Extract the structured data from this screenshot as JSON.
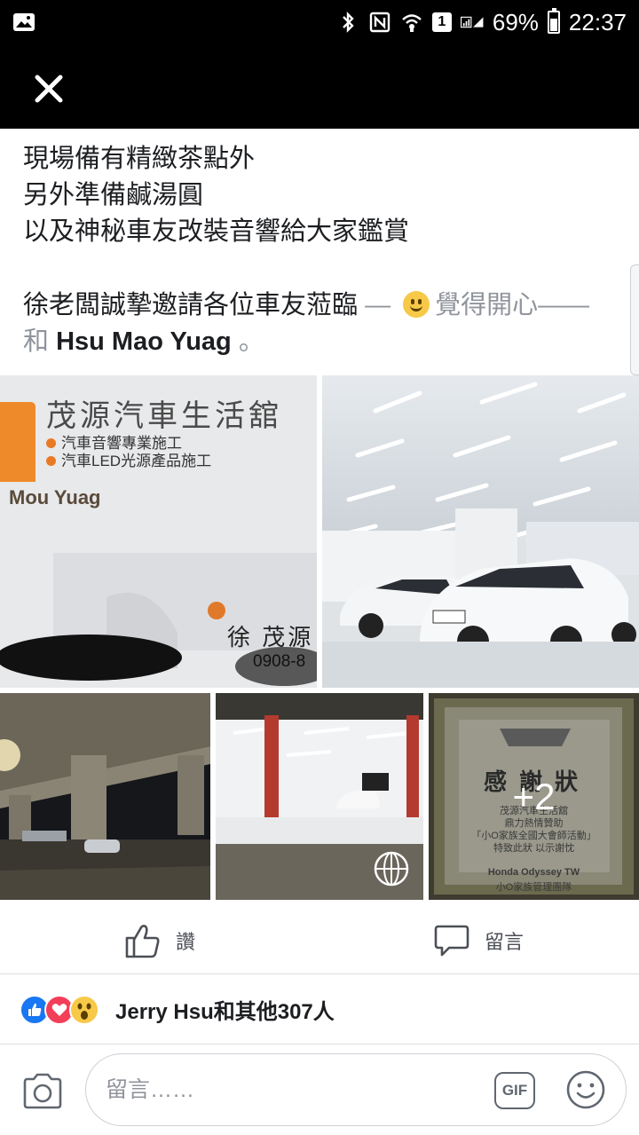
{
  "status_bar": {
    "battery": "69%",
    "battery_level": 0.69,
    "time": "22:37",
    "sim": "1",
    "icons": [
      "gallery-icon",
      "bluetooth-icon",
      "nfc-icon",
      "wifi-icon",
      "signal-icon",
      "battery-icon"
    ]
  },
  "post": {
    "lines": [
      "現場備有精緻茶點外",
      "另外準備鹹湯圓",
      "以及神秘車友改裝音響給大家鑑賞"
    ],
    "invite": "徐老闆誠摯邀請各位車友蒞臨",
    "feeling_separator": "—",
    "feeling": "覺得開心",
    "feeling_tail": "——",
    "with_word": "和",
    "tag_name": "Hsu Mao Yuag",
    "tag_end": "。"
  },
  "photos": {
    "card": {
      "title": "茂源汽車生活舘",
      "items": [
        "汽車音響專業施工",
        "汽車LED光源產品施工"
      ],
      "brand": "Mou Yuag",
      "person": "徐 茂源",
      "phone": "0908-8"
    },
    "plaque": {
      "title": "感謝狀",
      "lines": [
        "茂源汽車生活舘",
        "鼎力熱情贊助",
        "「小O家族全國大會師活動」",
        "特致此狀 以示謝忱"
      ],
      "org": "Honda Odyssey TW",
      "org_sub": "小O家族管理團隊"
    },
    "more_count": "+2"
  },
  "actions": {
    "like_label": "讚",
    "comment_label": "留言"
  },
  "reactions": {
    "summary": "Jerry Hsu和其他307人"
  },
  "composer": {
    "placeholder": "留言……",
    "gif_label": "GIF"
  },
  "colors": {
    "facebook_blue": "#1877f2",
    "love_red": "#f33e58",
    "wow_yellow": "#f7c948",
    "card_orange": "#e97a24"
  }
}
